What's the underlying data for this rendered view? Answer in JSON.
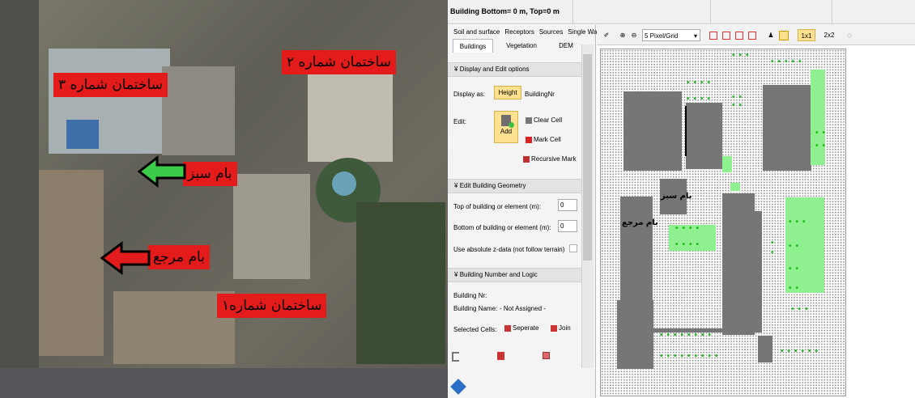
{
  "photo": {
    "labels": {
      "building1": "ساختمان شماره۱",
      "building2": "ساختمان شماره ۲",
      "building3": "ساختمان شماره ۳",
      "green_roof": "بام سبز",
      "reference_roof": "بام مرجع"
    },
    "colors": {
      "label_bg": "#e41b1b",
      "green_arrow": "#3dcb4a",
      "red_arrow": "#e21c1c"
    }
  },
  "window": {
    "title": "Building Bottom= 0 m, Top=0 m"
  },
  "tabs_top": [
    "Soil and surface",
    "Receptors",
    "Sources",
    "Single Walls"
  ],
  "tabs_bottom": [
    "Buildings",
    "Vegetation",
    "DEM"
  ],
  "sections": {
    "display_edit": {
      "header": "Display and Edit options",
      "display_as_label": "Display as:",
      "height_button": "Height",
      "buildingnr_button": "BuildingNr",
      "edit_label": "Edit:",
      "add_button": "Add",
      "clear_cell": "Clear Cell",
      "mark_cell": "Mark Cell",
      "recursive_mark": "Recursive Mark"
    },
    "geometry": {
      "header": "Edit Building Geometry",
      "top_label": "Top of building or element (m):",
      "top_value": "0",
      "bottom_label": "Bottom of building or element (m):",
      "bottom_value": "0",
      "absolute_label": "Use absolute z-data (not follow terrain)"
    },
    "number_logic": {
      "header": "Building Number and Logic",
      "building_nr_label": "Building Nr:",
      "building_name_label": "Building Name:",
      "building_name_value": "- Not Assigned -",
      "selected_cells_label": "Selected Cells:",
      "seperate_button": "Seperate",
      "join_button": "Join"
    }
  },
  "toolbar": {
    "zoom_select": "5 Pixel/Grid",
    "one_by_one": "1x1",
    "two_by_two": "2x2"
  },
  "grid": {
    "green_roof_label": "بام سبز",
    "reference_roof_label": "بام مرجع",
    "colors": {
      "building": "#767676",
      "vegetation": "#8ef08e",
      "tree": "#1fb81f"
    }
  }
}
